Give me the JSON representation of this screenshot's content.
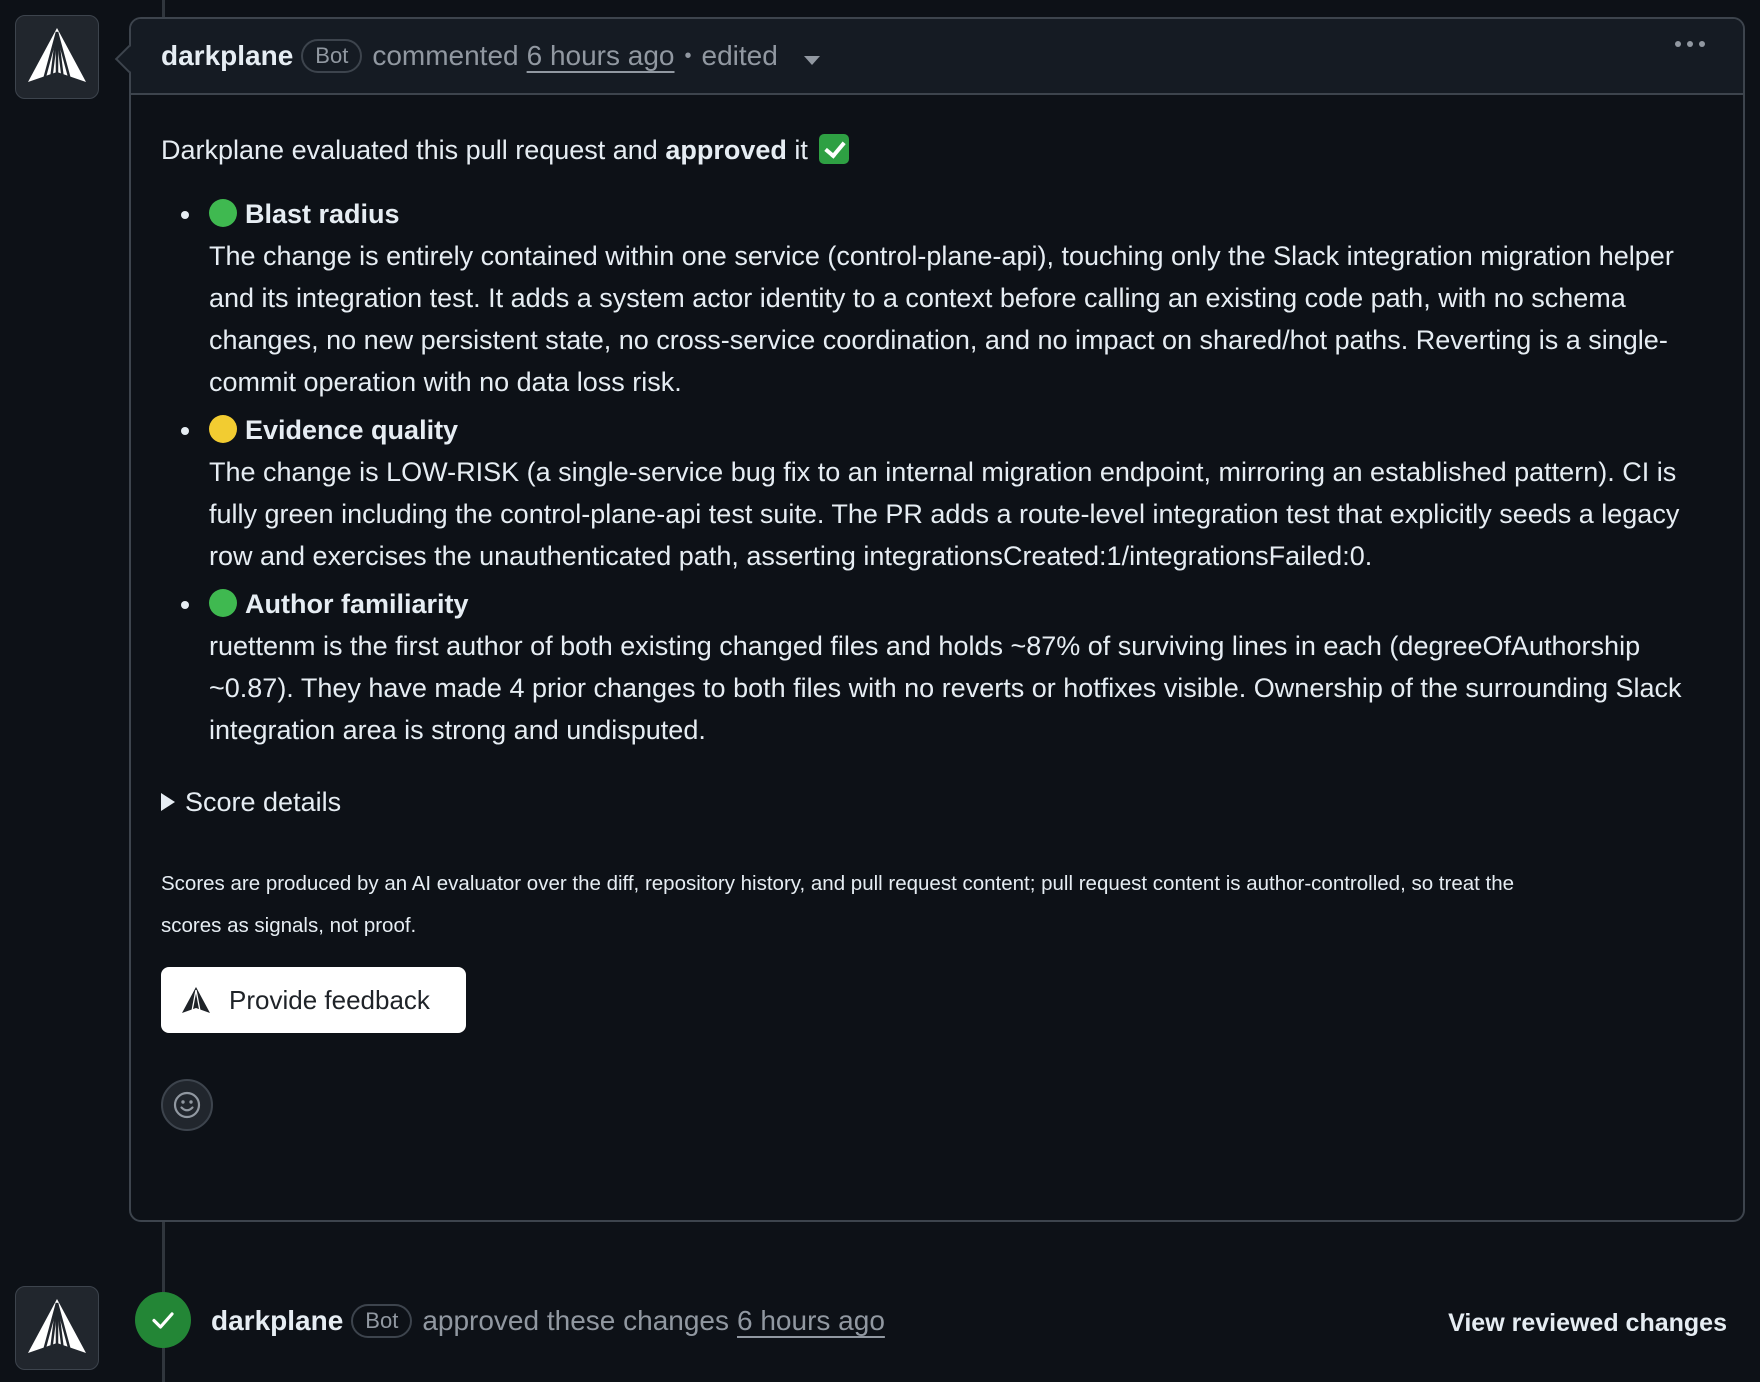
{
  "comment": {
    "author": "darkplane",
    "bot_badge": "Bot",
    "action": "commented",
    "time": "6 hours ago",
    "separator": "•",
    "edited": "edited",
    "intro_prefix": "Darkplane evaluated this pull request and ",
    "intro_bold": "approved",
    "intro_suffix": " it",
    "criteria": [
      {
        "status_color": "#3fb950",
        "title": "Blast radius",
        "text": "The change is entirely contained within one service (control-plane-api), touching only the Slack integration migration helper and its integration test. It adds a system actor identity to a context before calling an existing code path, with no schema changes, no new persistent state, no cross-service coordination, and no impact on shared/hot paths. Reverting is a single-commit operation with no data loss risk."
      },
      {
        "status_color": "#f2cc31",
        "title": "Evidence quality",
        "text": "The change is LOW-RISK (a single-service bug fix to an internal migration endpoint, mirroring an established pattern). CI is fully green including the control-plane-api test suite. The PR adds a route-level integration test that explicitly seeds a legacy row and exercises the unauthenticated path, asserting integrationsCreated:1/integrationsFailed:0."
      },
      {
        "status_color": "#3fb950",
        "title": "Author familiarity",
        "text": "ruettenm is the first author of both existing changed files and holds ~87% of surviving lines in each (degreeOfAuthorship ~0.87). They have made 4 prior changes to both files with no reverts or hotfixes visible. Ownership of the surrounding Slack integration area is strong and undisputed."
      }
    ],
    "score_details": "Score details",
    "disclaimer": "Scores are produced by an AI evaluator over the diff, repository history, and pull request content; pull request content is author-controlled, so treat the scores as signals, not proof.",
    "feedback_button": "Provide feedback"
  },
  "review": {
    "author": "darkplane",
    "bot_badge": "Bot",
    "action": "approved these changes",
    "time": "6 hours ago",
    "view_changes": "View reviewed changes"
  }
}
